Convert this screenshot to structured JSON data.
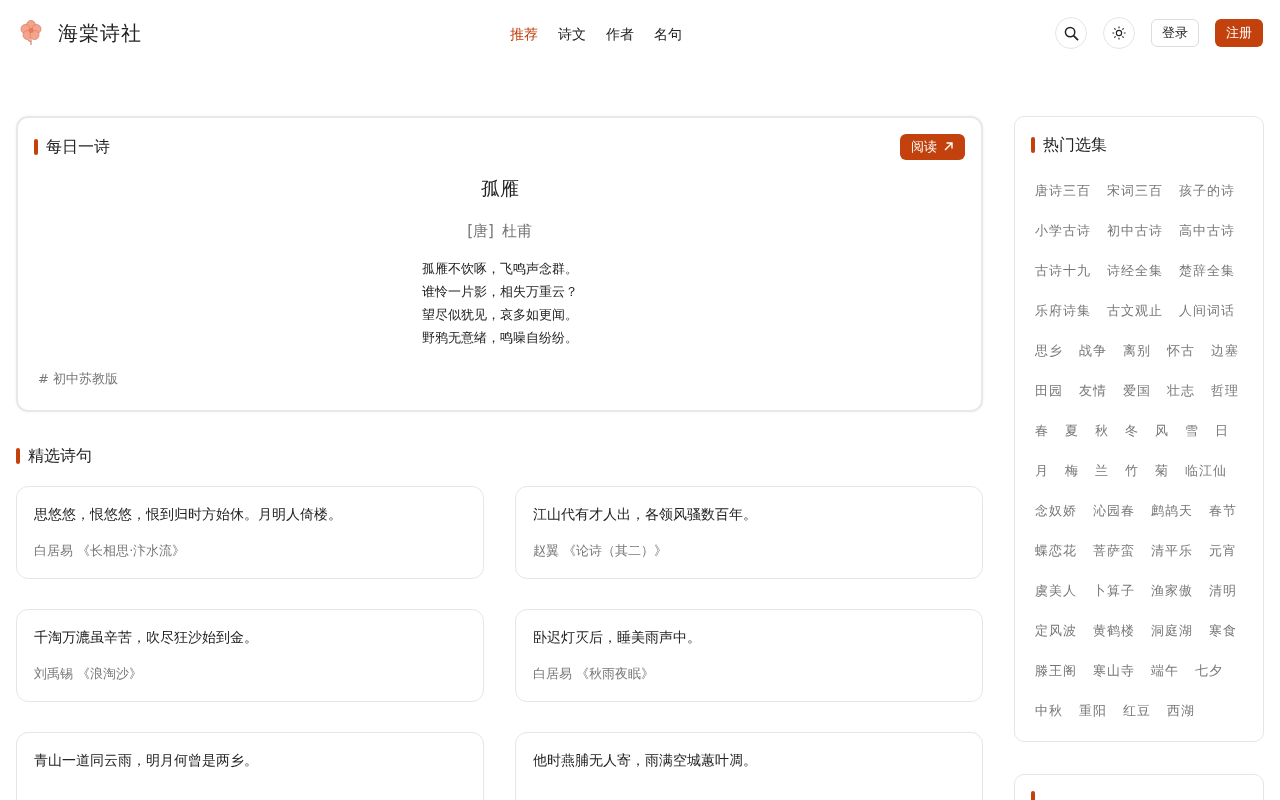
{
  "header": {
    "site_name": "海棠诗社",
    "nav": [
      {
        "label": "推荐",
        "selected": true
      },
      {
        "label": "诗文",
        "selected": false
      },
      {
        "label": "作者",
        "selected": false
      },
      {
        "label": "名句",
        "selected": false
      }
    ],
    "login_button": "登录",
    "register_button": "注册"
  },
  "daily": {
    "heading": "每日一诗",
    "read_button": "阅读",
    "title": "孤雁",
    "dynasty": "[唐]",
    "author": "杜甫",
    "lines": [
      "孤雁不饮啄，飞鸣声念群。",
      "谁怜一片影，相失万重云？",
      "望尽似犹见，哀多如更闻。",
      "野鸦无意绪，鸣噪自纷纷。"
    ],
    "tag": "# 初中苏教版"
  },
  "featured": {
    "heading": "精选诗句",
    "quotes": [
      {
        "text": "思悠悠，恨悠悠，恨到归时方始休。月明人倚楼。",
        "author": "白居易",
        "source": "《长相思·汴水流》"
      },
      {
        "text": "江山代有才人出，各领风骚数百年。",
        "author": "赵翼",
        "source": "《论诗（其二）》"
      },
      {
        "text": "千淘万漉虽辛苦，吹尽狂沙始到金。",
        "author": "刘禹锡",
        "source": "《浪淘沙》"
      },
      {
        "text": "卧迟灯灭后，睡美雨声中。",
        "author": "白居易",
        "source": "《秋雨夜眠》"
      },
      {
        "text": "青山一道同云雨，明月何曾是两乡。"
      },
      {
        "text": "他时燕脯无人寄，雨满空城蕙叶凋。"
      }
    ]
  },
  "sidebar": {
    "collections": {
      "heading": "热门选集",
      "tags": [
        "唐诗三百",
        "宋词三百",
        "孩子的诗",
        "小学古诗",
        "初中古诗",
        "高中古诗",
        "古诗十九",
        "诗经全集",
        "楚辞全集",
        "乐府诗集",
        "古文观止",
        "人间词话",
        "思乡",
        "战争",
        "离别",
        "怀古",
        "边塞",
        "田园",
        "友情",
        "爱国",
        "壮志",
        "哲理",
        "春",
        "夏",
        "秋",
        "冬",
        "风",
        "雪",
        "日",
        "月",
        "梅",
        "兰",
        "竹",
        "菊",
        "临江仙",
        "念奴娇",
        "沁园春",
        "鹧鸪天",
        "春节",
        "蝶恋花",
        "菩萨蛮",
        "清平乐",
        "元宵",
        "虞美人",
        "卜算子",
        "渔家傲",
        "清明",
        "定风波",
        "黄鹤楼",
        "洞庭湖",
        "寒食",
        "滕王阁",
        "寒山寺",
        "端午",
        "七夕",
        "中秋",
        "重阳",
        "红豆",
        "西湖"
      ]
    },
    "poets_panel": true
  }
}
